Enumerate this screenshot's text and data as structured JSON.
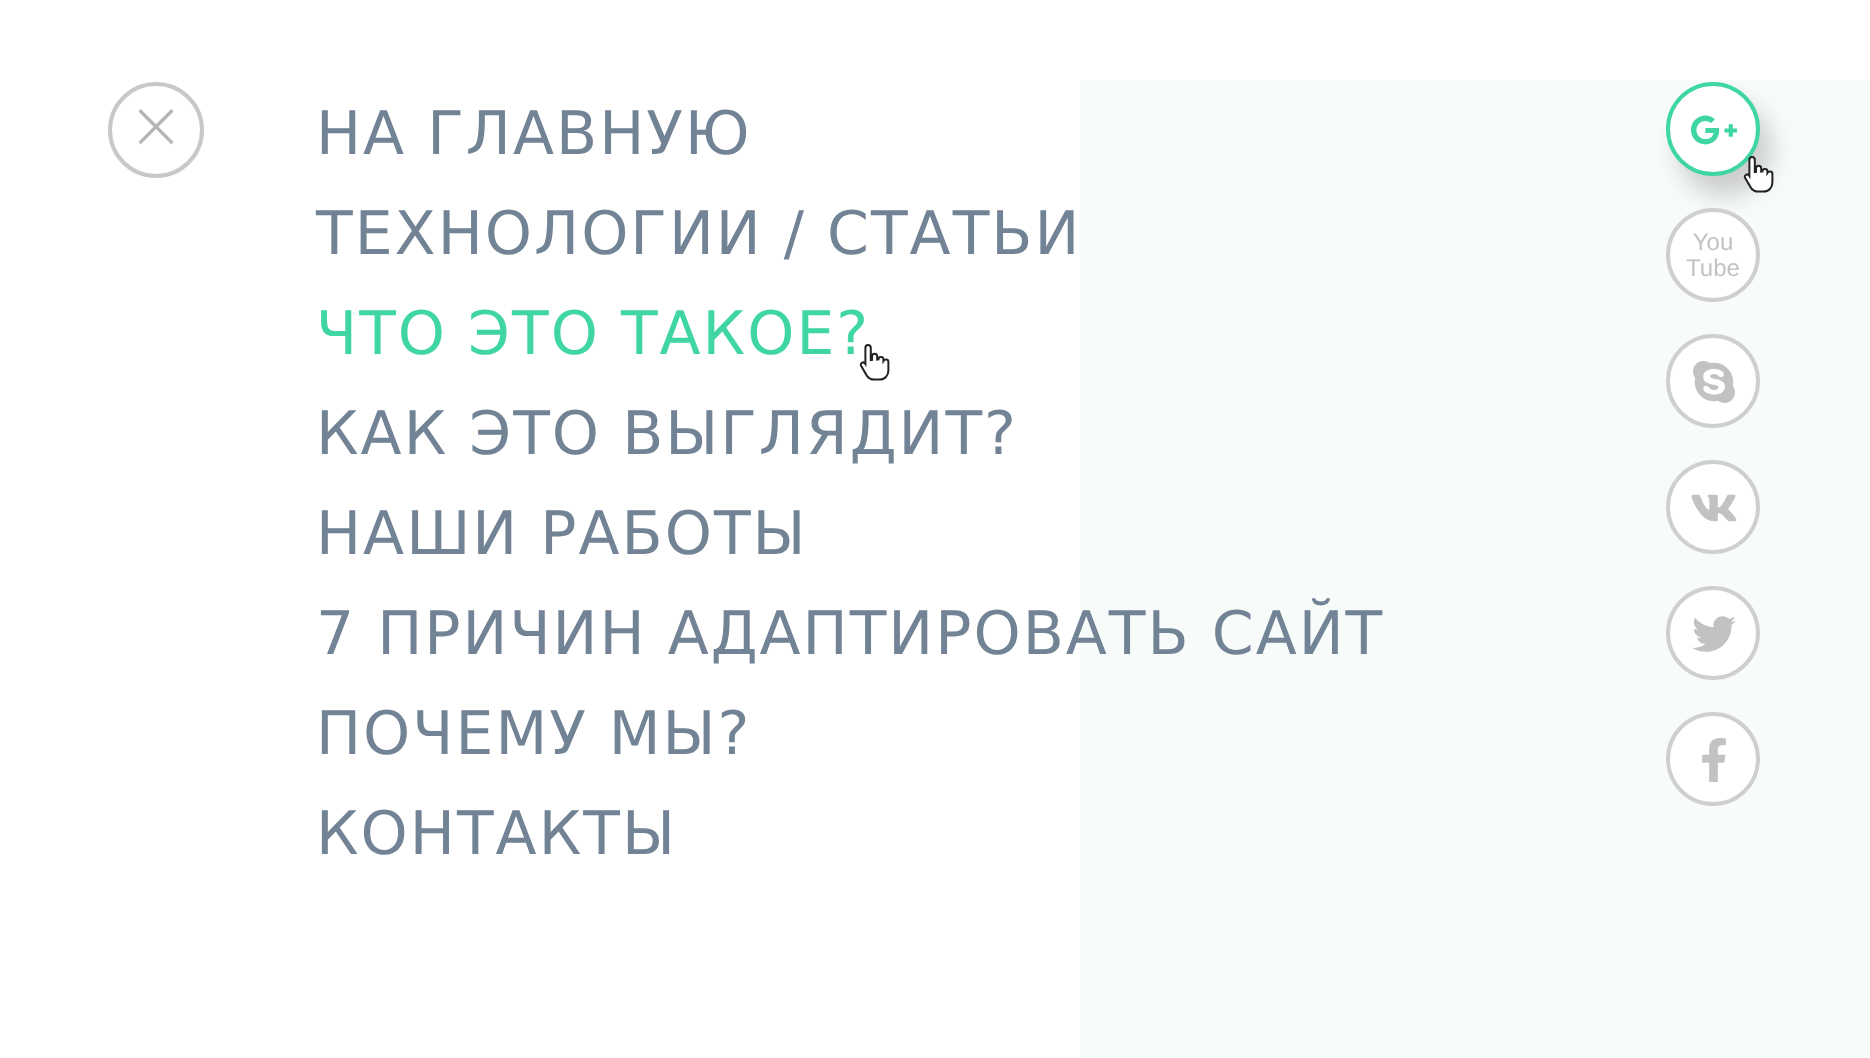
{
  "close_button": {
    "label": "×"
  },
  "menu": [
    {
      "label": "НА ГЛАВНУЮ",
      "hovered": false
    },
    {
      "label": "ТЕХНОЛОГИИ / СТАТЬИ",
      "hovered": false
    },
    {
      "label": "ЧТО ЭТО ТАКОЕ?",
      "hovered": true
    },
    {
      "label": "КАК ЭТО ВЫГЛЯДИТ?",
      "hovered": false
    },
    {
      "label": "НАШИ РАБОТЫ",
      "hovered": false
    },
    {
      "label": "7 ПРИЧИН АДАПТИРОВАТЬ САЙТ",
      "hovered": false
    },
    {
      "label": "ПОЧЕМУ МЫ?",
      "hovered": false
    },
    {
      "label": "КОНТАКТЫ",
      "hovered": false
    }
  ],
  "social": [
    {
      "kind": "google_plus",
      "hovered": true
    },
    {
      "kind": "youtube",
      "label_top": "You",
      "label_bottom": "Tube",
      "hovered": false
    },
    {
      "kind": "skype",
      "hovered": false
    },
    {
      "kind": "vk",
      "hovered": false
    },
    {
      "kind": "twitter",
      "hovered": false
    },
    {
      "kind": "facebook",
      "hovered": false
    }
  ]
}
